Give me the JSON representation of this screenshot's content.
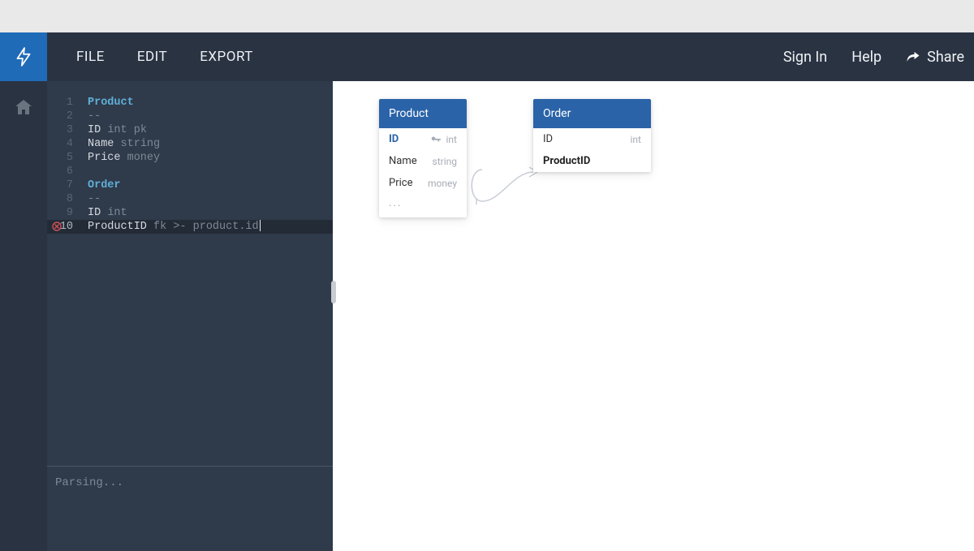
{
  "nav": {
    "menu": {
      "file": "FILE",
      "edit": "EDIT",
      "export": "EXPORT"
    },
    "signin": "Sign In",
    "help": "Help",
    "share": "Share"
  },
  "editor": {
    "lines": [
      {
        "n": "1",
        "tokens": [
          {
            "cls": "tok-entity",
            "t": "Product"
          }
        ]
      },
      {
        "n": "2",
        "tokens": [
          {
            "cls": "tok-type",
            "t": "--"
          }
        ]
      },
      {
        "n": "3",
        "tokens": [
          {
            "cls": "tok-field",
            "t": "ID "
          },
          {
            "cls": "tok-type",
            "t": "int pk"
          }
        ]
      },
      {
        "n": "4",
        "tokens": [
          {
            "cls": "tok-field",
            "t": "Name "
          },
          {
            "cls": "tok-type",
            "t": "string"
          }
        ]
      },
      {
        "n": "5",
        "tokens": [
          {
            "cls": "tok-field",
            "t": "Price "
          },
          {
            "cls": "tok-type",
            "t": "money"
          }
        ]
      },
      {
        "n": "6",
        "tokens": []
      },
      {
        "n": "7",
        "tokens": [
          {
            "cls": "tok-entity",
            "t": "Order"
          }
        ]
      },
      {
        "n": "8",
        "tokens": [
          {
            "cls": "tok-type",
            "t": "--"
          }
        ]
      },
      {
        "n": "9",
        "tokens": [
          {
            "cls": "tok-field",
            "t": "ID "
          },
          {
            "cls": "tok-type",
            "t": "int"
          }
        ]
      },
      {
        "n": "10",
        "error": true,
        "active": true,
        "cursor": true,
        "tokens": [
          {
            "cls": "tok-field",
            "t": "ProductID "
          },
          {
            "cls": "tok-type",
            "t": "fk >- product.id"
          }
        ]
      }
    ],
    "status": "Parsing..."
  },
  "tables": {
    "product": {
      "title": "Product",
      "rows": [
        {
          "name": "ID",
          "type": "int",
          "pk": true,
          "key": true
        },
        {
          "name": "Name",
          "type": "string"
        },
        {
          "name": "Price",
          "type": "money"
        }
      ],
      "more": "..."
    },
    "order": {
      "title": "Order",
      "rows": [
        {
          "name": "ID",
          "type": "int"
        },
        {
          "name": "ProductID",
          "type": "",
          "bold": true
        }
      ]
    }
  }
}
